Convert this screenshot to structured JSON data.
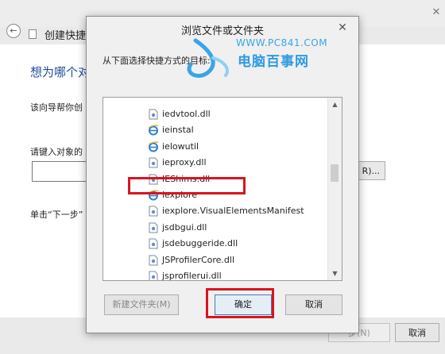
{
  "background_window": {
    "back_icon": "back-arrow-icon",
    "title": "创建快捷",
    "heading": "想为哪个对",
    "text1": "该向导帮你创",
    "text2": "请键入对象的",
    "browse_button": "R)...",
    "text3": "单击“下一步”",
    "next_button": "步(N)",
    "cancel_button": "取消",
    "close_icon": "close-icon"
  },
  "dialog": {
    "title": "浏览文件或文件夹",
    "close_icon": "close-icon",
    "label": "从下面选择快捷方式的目标:",
    "watermark": {
      "url": "WWW.PC841.COM",
      "name": "电脑百事网"
    },
    "tree_items": [
      {
        "label": "iedvtool.dll",
        "icon": "dll-file-icon"
      },
      {
        "label": "ieinstal",
        "icon": "ie-icon"
      },
      {
        "label": "ielowutil",
        "icon": "ie-icon"
      },
      {
        "label": "ieproxy.dll",
        "icon": "dll-file-icon"
      },
      {
        "label": "IEShims.dll",
        "icon": "dll-file-icon"
      },
      {
        "label": "iexplore",
        "icon": "ie-icon",
        "selected_highlight": true
      },
      {
        "label": "iexplore.VisualElementsManifest",
        "icon": "dll-file-icon"
      },
      {
        "label": "jsdbgui.dll",
        "icon": "dll-file-icon"
      },
      {
        "label": "jsdebuggeride.dll",
        "icon": "dll-file-icon"
      },
      {
        "label": "JSProfilerCore.dll",
        "icon": "dll-file-icon"
      },
      {
        "label": "jsprofilerui.dll",
        "icon": "dll-file-icon"
      }
    ],
    "buttons": {
      "new_folder": "新建文件夹(M)",
      "ok": "确定",
      "cancel": "取消"
    }
  },
  "colors": {
    "highlight_red": "#d9141f",
    "watermark_blue": "#2f9be0",
    "heading_blue": "#1f4e9c"
  }
}
